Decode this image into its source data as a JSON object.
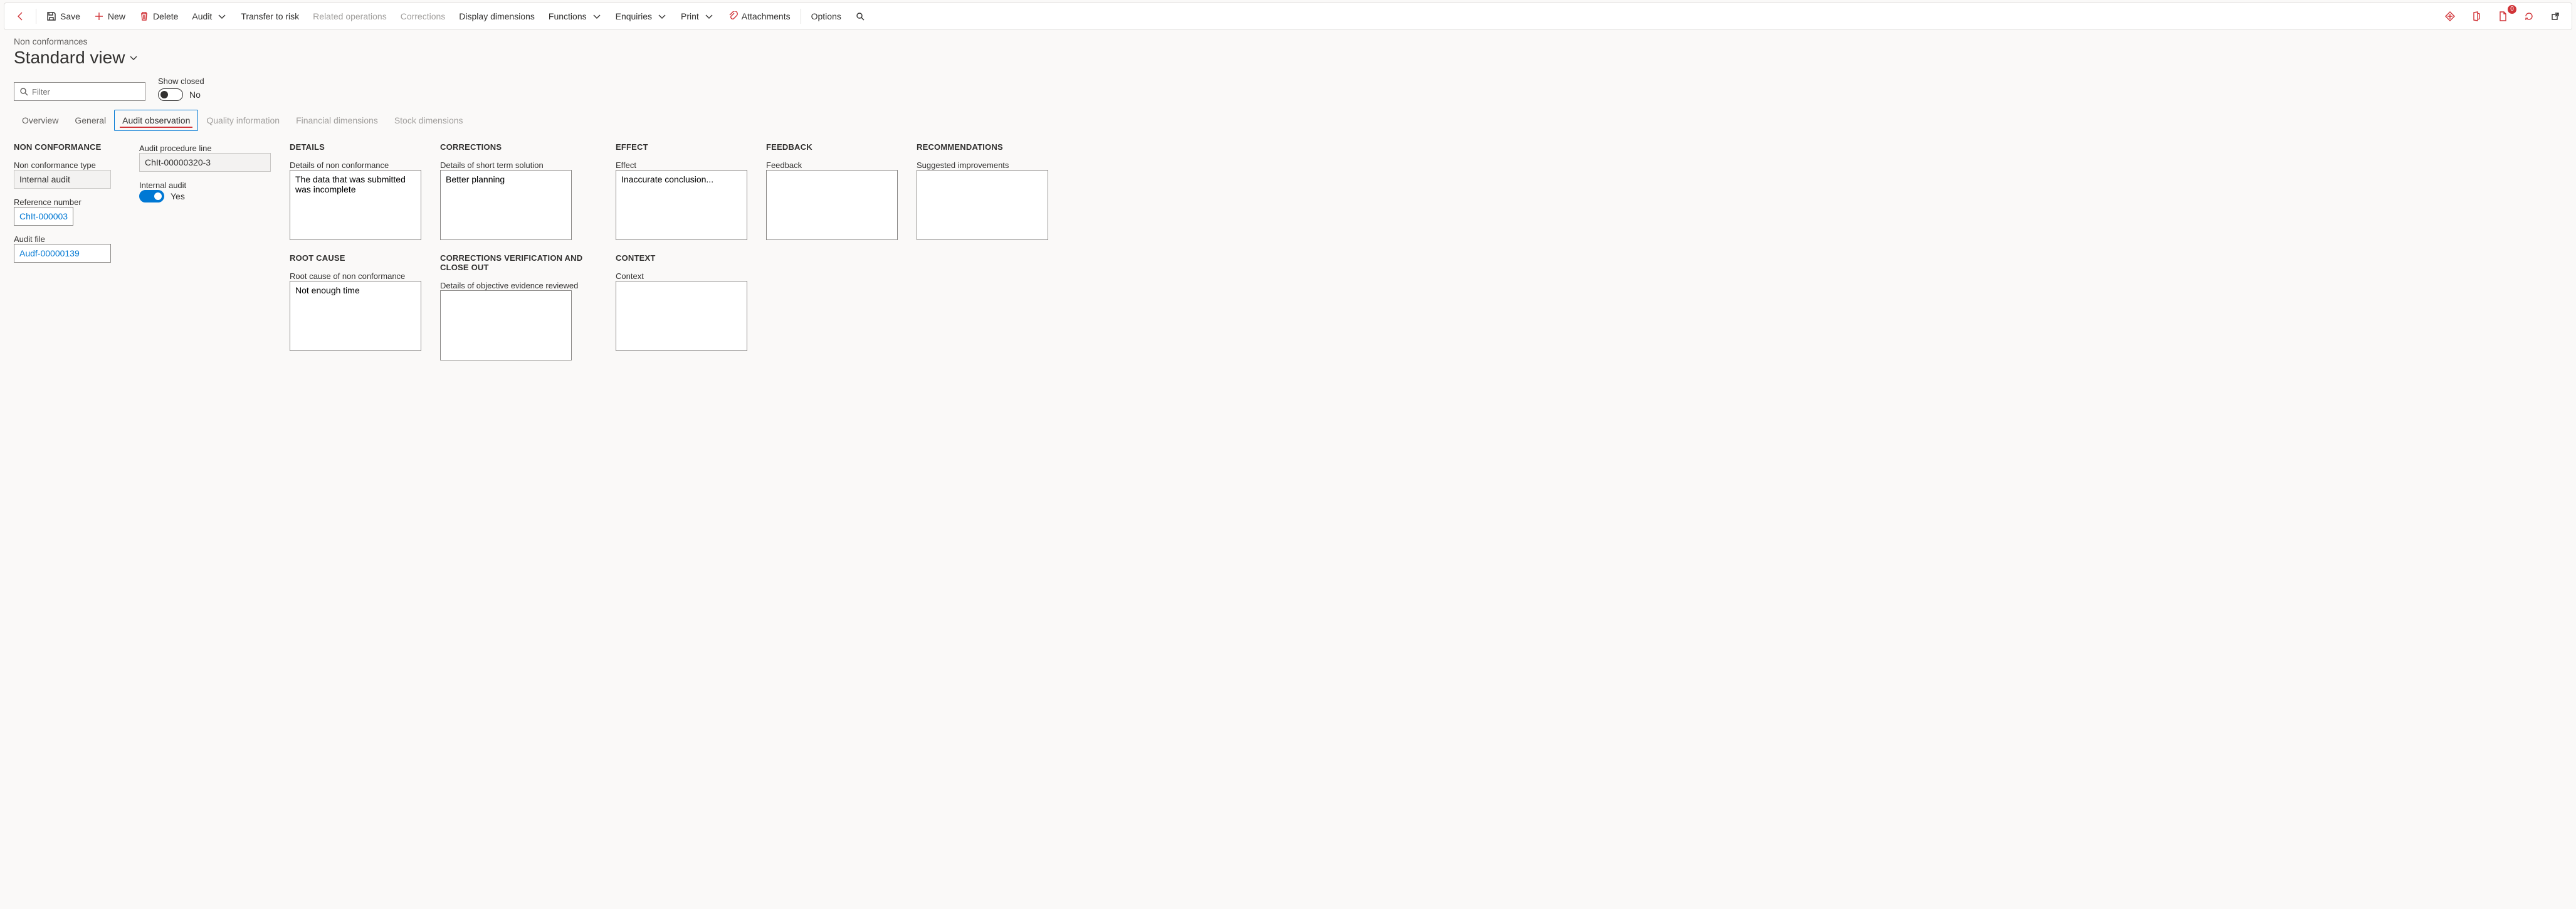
{
  "toolbar": {
    "save": "Save",
    "new": "New",
    "delete": "Delete",
    "audit": "Audit",
    "transfer": "Transfer to risk",
    "related_ops": "Related operations",
    "corrections": "Corrections",
    "display_dims": "Display dimensions",
    "functions": "Functions",
    "enquiries": "Enquiries",
    "print": "Print",
    "attachments": "Attachments",
    "options": "Options",
    "badge_count": "0"
  },
  "page": {
    "breadcrumb": "Non conformances",
    "view_title": "Standard view"
  },
  "filter": {
    "placeholder": "Filter"
  },
  "show_closed": {
    "label": "Show closed",
    "value_text": "No"
  },
  "tabs": {
    "overview": "Overview",
    "general": "General",
    "audit_obs": "Audit observation",
    "quality": "Quality information",
    "fin_dims": "Financial dimensions",
    "stock_dims": "Stock dimensions"
  },
  "nc": {
    "section": "NON CONFORMANCE",
    "type_label": "Non conformance type",
    "type_value": "Internal audit",
    "ref_label": "Reference number",
    "ref_value": "ChIt-000003...",
    "file_label": "Audit file",
    "file_value": "Audf-00000139"
  },
  "ap": {
    "line_label": "Audit procedure line",
    "line_value": "ChIt-00000320-3",
    "ia_label": "Internal audit",
    "ia_text": "Yes"
  },
  "details": {
    "section": "DETAILS",
    "label": "Details of non conformance",
    "value": "The data that was submitted was incomplete"
  },
  "rootcause": {
    "section": "ROOT CAUSE",
    "label": "Root cause of non conformance",
    "value": "Not enough time"
  },
  "corr": {
    "section": "CORRECTIONS",
    "label": "Details of short term solution",
    "value": "Better planning"
  },
  "cvco": {
    "section": "CORRECTIONS VERIFICATION AND CLOSE OUT",
    "label": "Details of objective evidence reviewed",
    "value": ""
  },
  "effect": {
    "section": "EFFECT",
    "label": "Effect",
    "value": "Inaccurate conclusion..."
  },
  "context": {
    "section": "CONTEXT",
    "label": "Context",
    "value": ""
  },
  "feedback": {
    "section": "FEEDBACK",
    "label": "Feedback",
    "value": ""
  },
  "recs": {
    "section": "RECOMMENDATIONS",
    "label": "Suggested improvements",
    "value": ""
  }
}
